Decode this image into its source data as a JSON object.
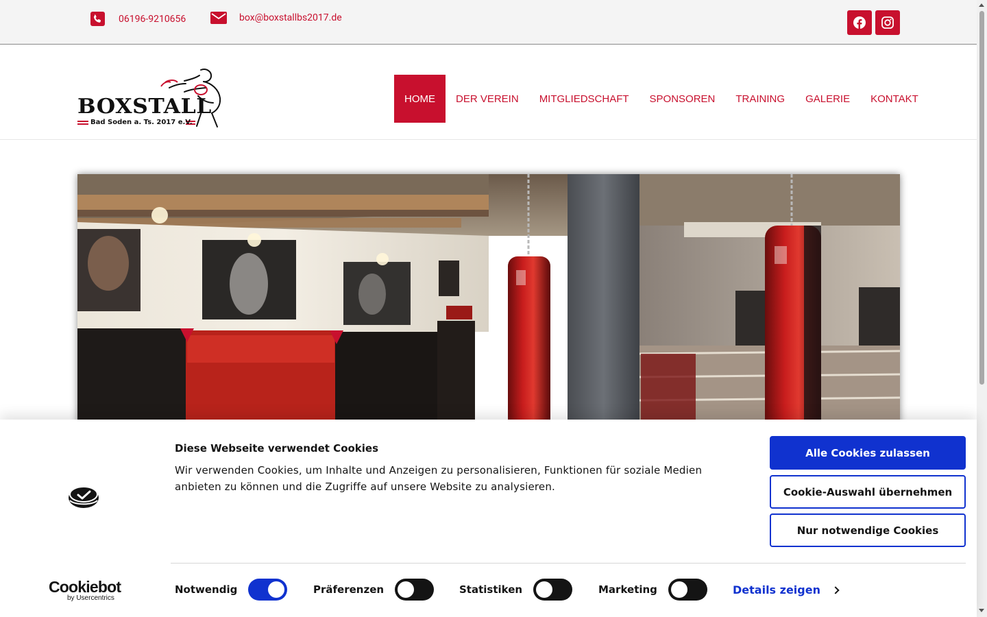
{
  "topbar": {
    "phone": "06196-9210656",
    "email": "box@boxstallbs2017.de",
    "social": [
      "facebook-icon",
      "instagram-icon"
    ],
    "accent_color": "#c8102e"
  },
  "logo": {
    "title": "BOXSTALL",
    "subtitle": "Bad Soden a. Ts. 2017 e.V."
  },
  "nav": {
    "items": [
      {
        "label": "HOME",
        "active": true
      },
      {
        "label": "DER VEREIN"
      },
      {
        "label": "MITGLIEDSCHAFT"
      },
      {
        "label": "SPONSOREN"
      },
      {
        "label": "TRAINING"
      },
      {
        "label": "GALERIE"
      },
      {
        "label": "KONTAKT"
      }
    ]
  },
  "cookie": {
    "title": "Diese Webseite verwendet Cookies",
    "text": "Wir verwenden Cookies, um Inhalte und Anzeigen zu personalisieren, Funktionen für soziale Medien anbieten zu können und die Zugriffe auf unsere Website zu analysieren.",
    "buttons": {
      "allow_all": "Alle Cookies zulassen",
      "allow_selection": "Cookie-Auswahl übernehmen",
      "necessary_only": "Nur notwendige Cookies"
    },
    "toggles": [
      {
        "label": "Notwendig",
        "on": true
      },
      {
        "label": "Präferenzen",
        "on": false
      },
      {
        "label": "Statistiken",
        "on": false
      },
      {
        "label": "Marketing",
        "on": false
      }
    ],
    "details_link": "Details zeigen",
    "brand": "Cookiebot",
    "brand_sub": "by Usercentrics",
    "accent_color": "#1032cf"
  }
}
